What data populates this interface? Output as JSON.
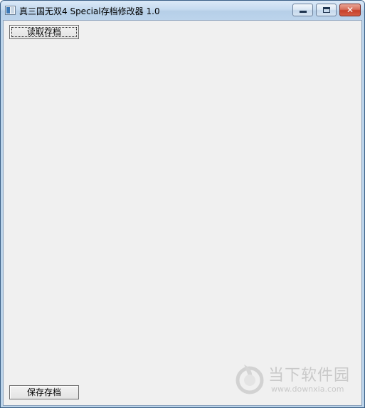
{
  "window": {
    "title": "真三国无双4 Special存档修改器 1.0",
    "close_glyph": "✕"
  },
  "buttons": {
    "load_label": "读取存档",
    "save_label": "保存存档"
  },
  "watermark": {
    "brand": "当下软件园",
    "url": "www.downxia.com"
  },
  "icons": {
    "app": "app-window-icon",
    "minimize": "minimize-icon",
    "maximize": "maximize-icon",
    "close": "close-icon",
    "watermark_logo": "downxia-logo-icon"
  },
  "colors": {
    "client_bg": "#f0f0f0",
    "titlebar": "#c6dbf0",
    "close_button": "#c7402a",
    "watermark": "#c9c9c9"
  }
}
